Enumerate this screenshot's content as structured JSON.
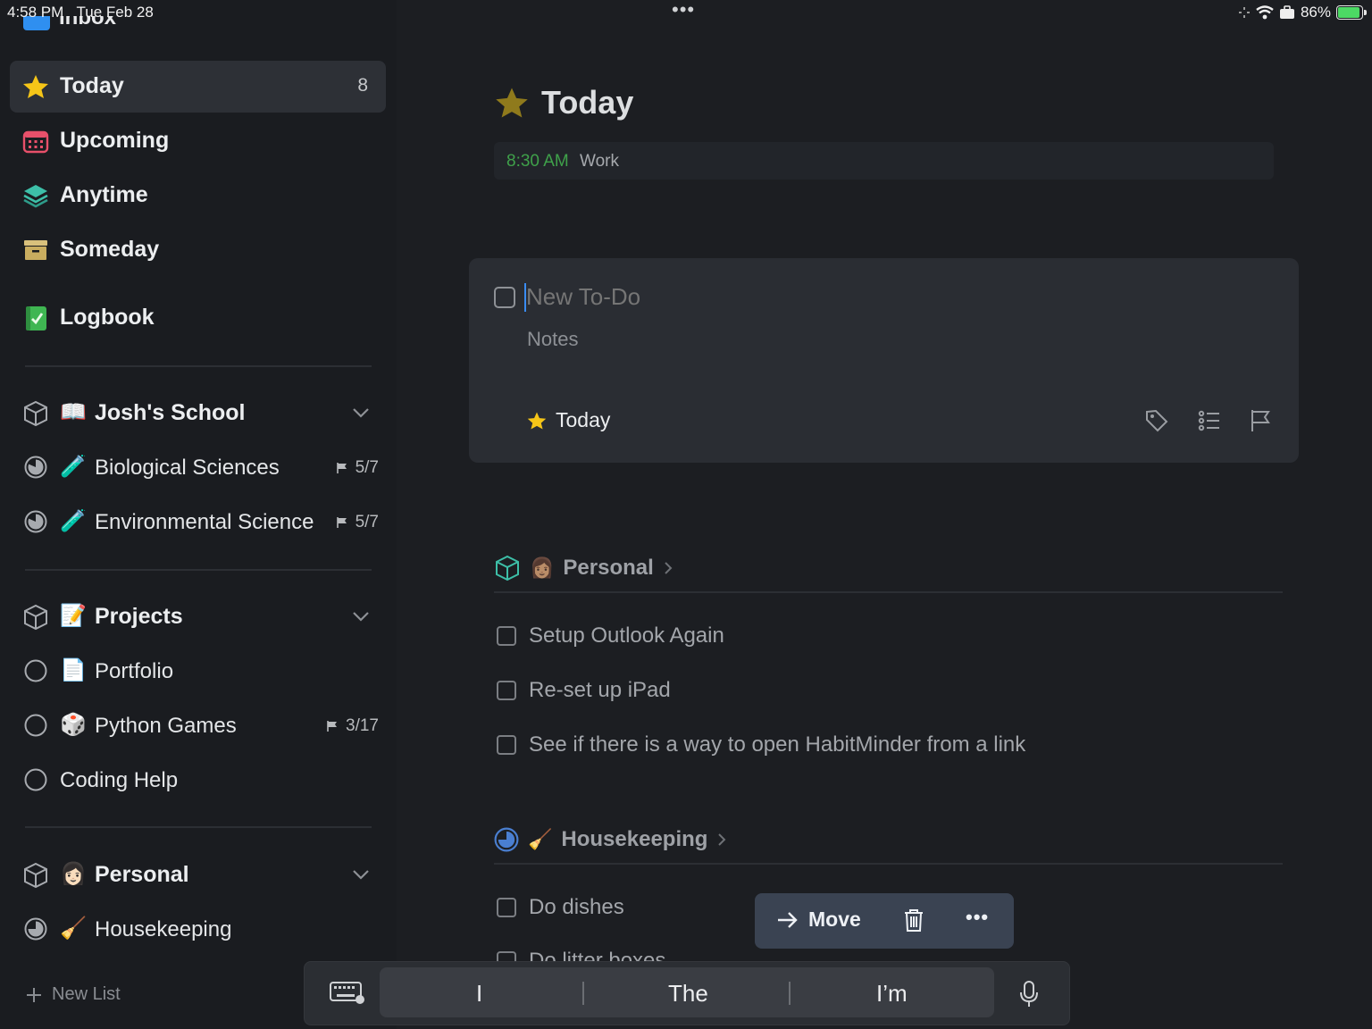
{
  "status_bar": {
    "time": "4:58 PM",
    "date": "Tue Feb 28",
    "battery": "86%"
  },
  "sidebar": {
    "inbox_label": "Inbox",
    "nav": [
      {
        "label": "Today",
        "count": "8"
      },
      {
        "label": "Upcoming"
      },
      {
        "label": "Anytime"
      },
      {
        "label": "Someday"
      },
      {
        "label": "Logbook"
      }
    ],
    "areas": [
      {
        "emoji": "📖",
        "label": "Josh's School",
        "projects": [
          {
            "emoji": "🧪",
            "label": "Biological Sciences",
            "progress": "5/7"
          },
          {
            "emoji": "🧪",
            "label": "Environmental Science",
            "progress": "5/7"
          }
        ]
      },
      {
        "emoji": "📝",
        "label": "Projects",
        "projects": [
          {
            "emoji": "📄",
            "label": "Portfolio"
          },
          {
            "emoji": "🎲",
            "label": "Python Games",
            "progress": "3/17"
          },
          {
            "label": "Coding Help"
          }
        ]
      },
      {
        "emoji": "👩🏻",
        "label": "Personal",
        "projects": [
          {
            "emoji": "🧹",
            "label": "Housekeeping"
          }
        ]
      }
    ],
    "new_list": "New List"
  },
  "main": {
    "title": "Today",
    "calendar_event": {
      "time": "8:30 AM",
      "title": "Work"
    },
    "editor": {
      "title_placeholder": "New To-Do",
      "notes_placeholder": "Notes",
      "when": "Today"
    },
    "sections": [
      {
        "emoji": "👩🏽",
        "name": "Personal",
        "todos": [
          "Setup Outlook Again",
          "Re-set up iPad",
          "See if there is a way to open HabitMinder from a link"
        ]
      },
      {
        "emoji": "🧹",
        "name": "Housekeeping",
        "todos": [
          "Do dishes",
          "Do litter boxes"
        ]
      }
    ]
  },
  "selection_toolbar": {
    "move": "Move"
  },
  "keyboard_bar": {
    "suggestions": [
      "I",
      "The",
      "I’m"
    ]
  },
  "colors": {
    "background": "#1c1e22",
    "sidebar": "#1a1c20",
    "today_star": "#f5c518",
    "calendar_time": "#3fa14a",
    "selection_bar": "#3a4352",
    "cursor": "#3a8cf2"
  }
}
